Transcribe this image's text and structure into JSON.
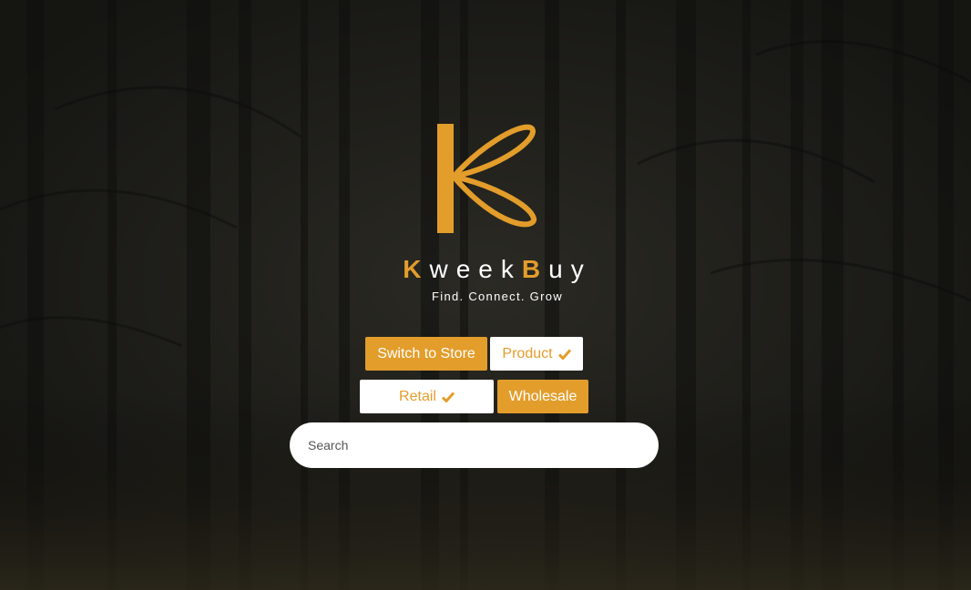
{
  "brand": {
    "name_parts": [
      "K",
      "week",
      "B",
      "uy"
    ],
    "tagline": "Find. Connect. Grow",
    "logo_icon": "kb-monogram-icon"
  },
  "actions": {
    "switch_store_label": "Switch to Store",
    "product_label": "Product",
    "retail_label": "Retail",
    "wholesale_label": "Wholesale",
    "check_icon": "check-icon"
  },
  "search": {
    "placeholder": "Search",
    "value": ""
  },
  "colors": {
    "accent": "#e39d2b",
    "background": "#1c1c19",
    "button_light": "#ffffff"
  }
}
